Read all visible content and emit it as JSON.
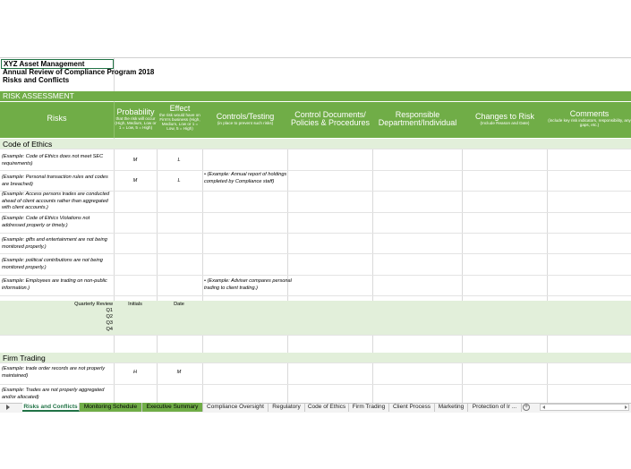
{
  "titles": {
    "company": "XYZ Asset Management",
    "review": "Annual Review of Compliance Program 2018",
    "subtitle": "Risks and Conflicts"
  },
  "risk_assessment_label": "RISK ASSESSMENT",
  "headers": {
    "risks": "Risks",
    "probability": "Probability",
    "probability_note": "that the risk will occur (High, Medium, Low or 1 = Low, 5 = High)",
    "effect": "Effect",
    "effect_note": "the risk would have on Firm's business (High, Medium, Low or 1 = Low, 5 = High)",
    "controls": "Controls/Testing",
    "controls_note": "(in place to prevent such risks)",
    "control_docs": "Control Documents/ Policies & Procedures",
    "responsible": "Responsible Department/Individual",
    "changes": "Changes to Risk",
    "changes_note": "(Include Reason and Date)",
    "comments": "Comments",
    "comments_note": "(include key risk indicators, responsibility, any gaps, etc.)"
  },
  "sections": {
    "code_of_ethics": "Code of Ethics",
    "firm_trading": "Firm Trading"
  },
  "ethics_rows": [
    {
      "risk": "(Example: Code of Ethics does not meet SEC requirements)",
      "prob": "M",
      "effect": "L",
      "control": ""
    },
    {
      "risk": "(Example: Personal transaction rules and codes are breached)",
      "prob": "M",
      "effect": "L",
      "control": "• (Example: Annual report of holdings completed by Compliance staff)"
    },
    {
      "risk": "(Example: Access persons trades are conducted ahead of client accounts rather than aggregated with client accounts.)",
      "prob": "",
      "effect": "",
      "control": ""
    },
    {
      "risk": "(Example: Code of Ethics Violations not addressed properly or timely.)",
      "prob": "",
      "effect": "",
      "control": ""
    },
    {
      "risk": "(Example: gifts and entertainment are not being monitored properly.)",
      "prob": "",
      "effect": "",
      "control": ""
    },
    {
      "risk": "(Example: political contributions are not being monitored properly.)",
      "prob": "",
      "effect": "",
      "control": ""
    },
    {
      "risk": "(Example: Employees are trading on non-public information.)",
      "prob": "",
      "effect": "",
      "control": "• (Example: Adviser compares personal trading to client trading.)"
    }
  ],
  "quarterly": {
    "label": "Quarterly Review",
    "initials": "Initials",
    "date": "Date",
    "quarters": [
      "Q1",
      "Q2",
      "Q3",
      "Q4"
    ]
  },
  "trading_rows": [
    {
      "risk": "(Example: trade order records are not properly maintained)",
      "prob": "H",
      "effect": "M"
    },
    {
      "risk": "(Example: Trades are not properly aggregated and/or allocated)",
      "prob": "",
      "effect": ""
    }
  ],
  "tabs": [
    {
      "label": "Risks and Conflicts",
      "state": "active"
    },
    {
      "label": "Monitoring Schedule",
      "state": "green"
    },
    {
      "label": "Executive Summary",
      "state": "green"
    },
    {
      "label": "Compliance Oversight",
      "state": ""
    },
    {
      "label": "Regulatory",
      "state": ""
    },
    {
      "label": "Code of Ethics",
      "state": ""
    },
    {
      "label": "Firm Trading",
      "state": ""
    },
    {
      "label": "Client Process",
      "state": ""
    },
    {
      "label": "Marketing",
      "state": ""
    },
    {
      "label": "Protection of Ir ...",
      "state": ""
    }
  ],
  "colors": {
    "accent": "#70ad47",
    "light": "#e2efda",
    "excel_green": "#217346"
  }
}
